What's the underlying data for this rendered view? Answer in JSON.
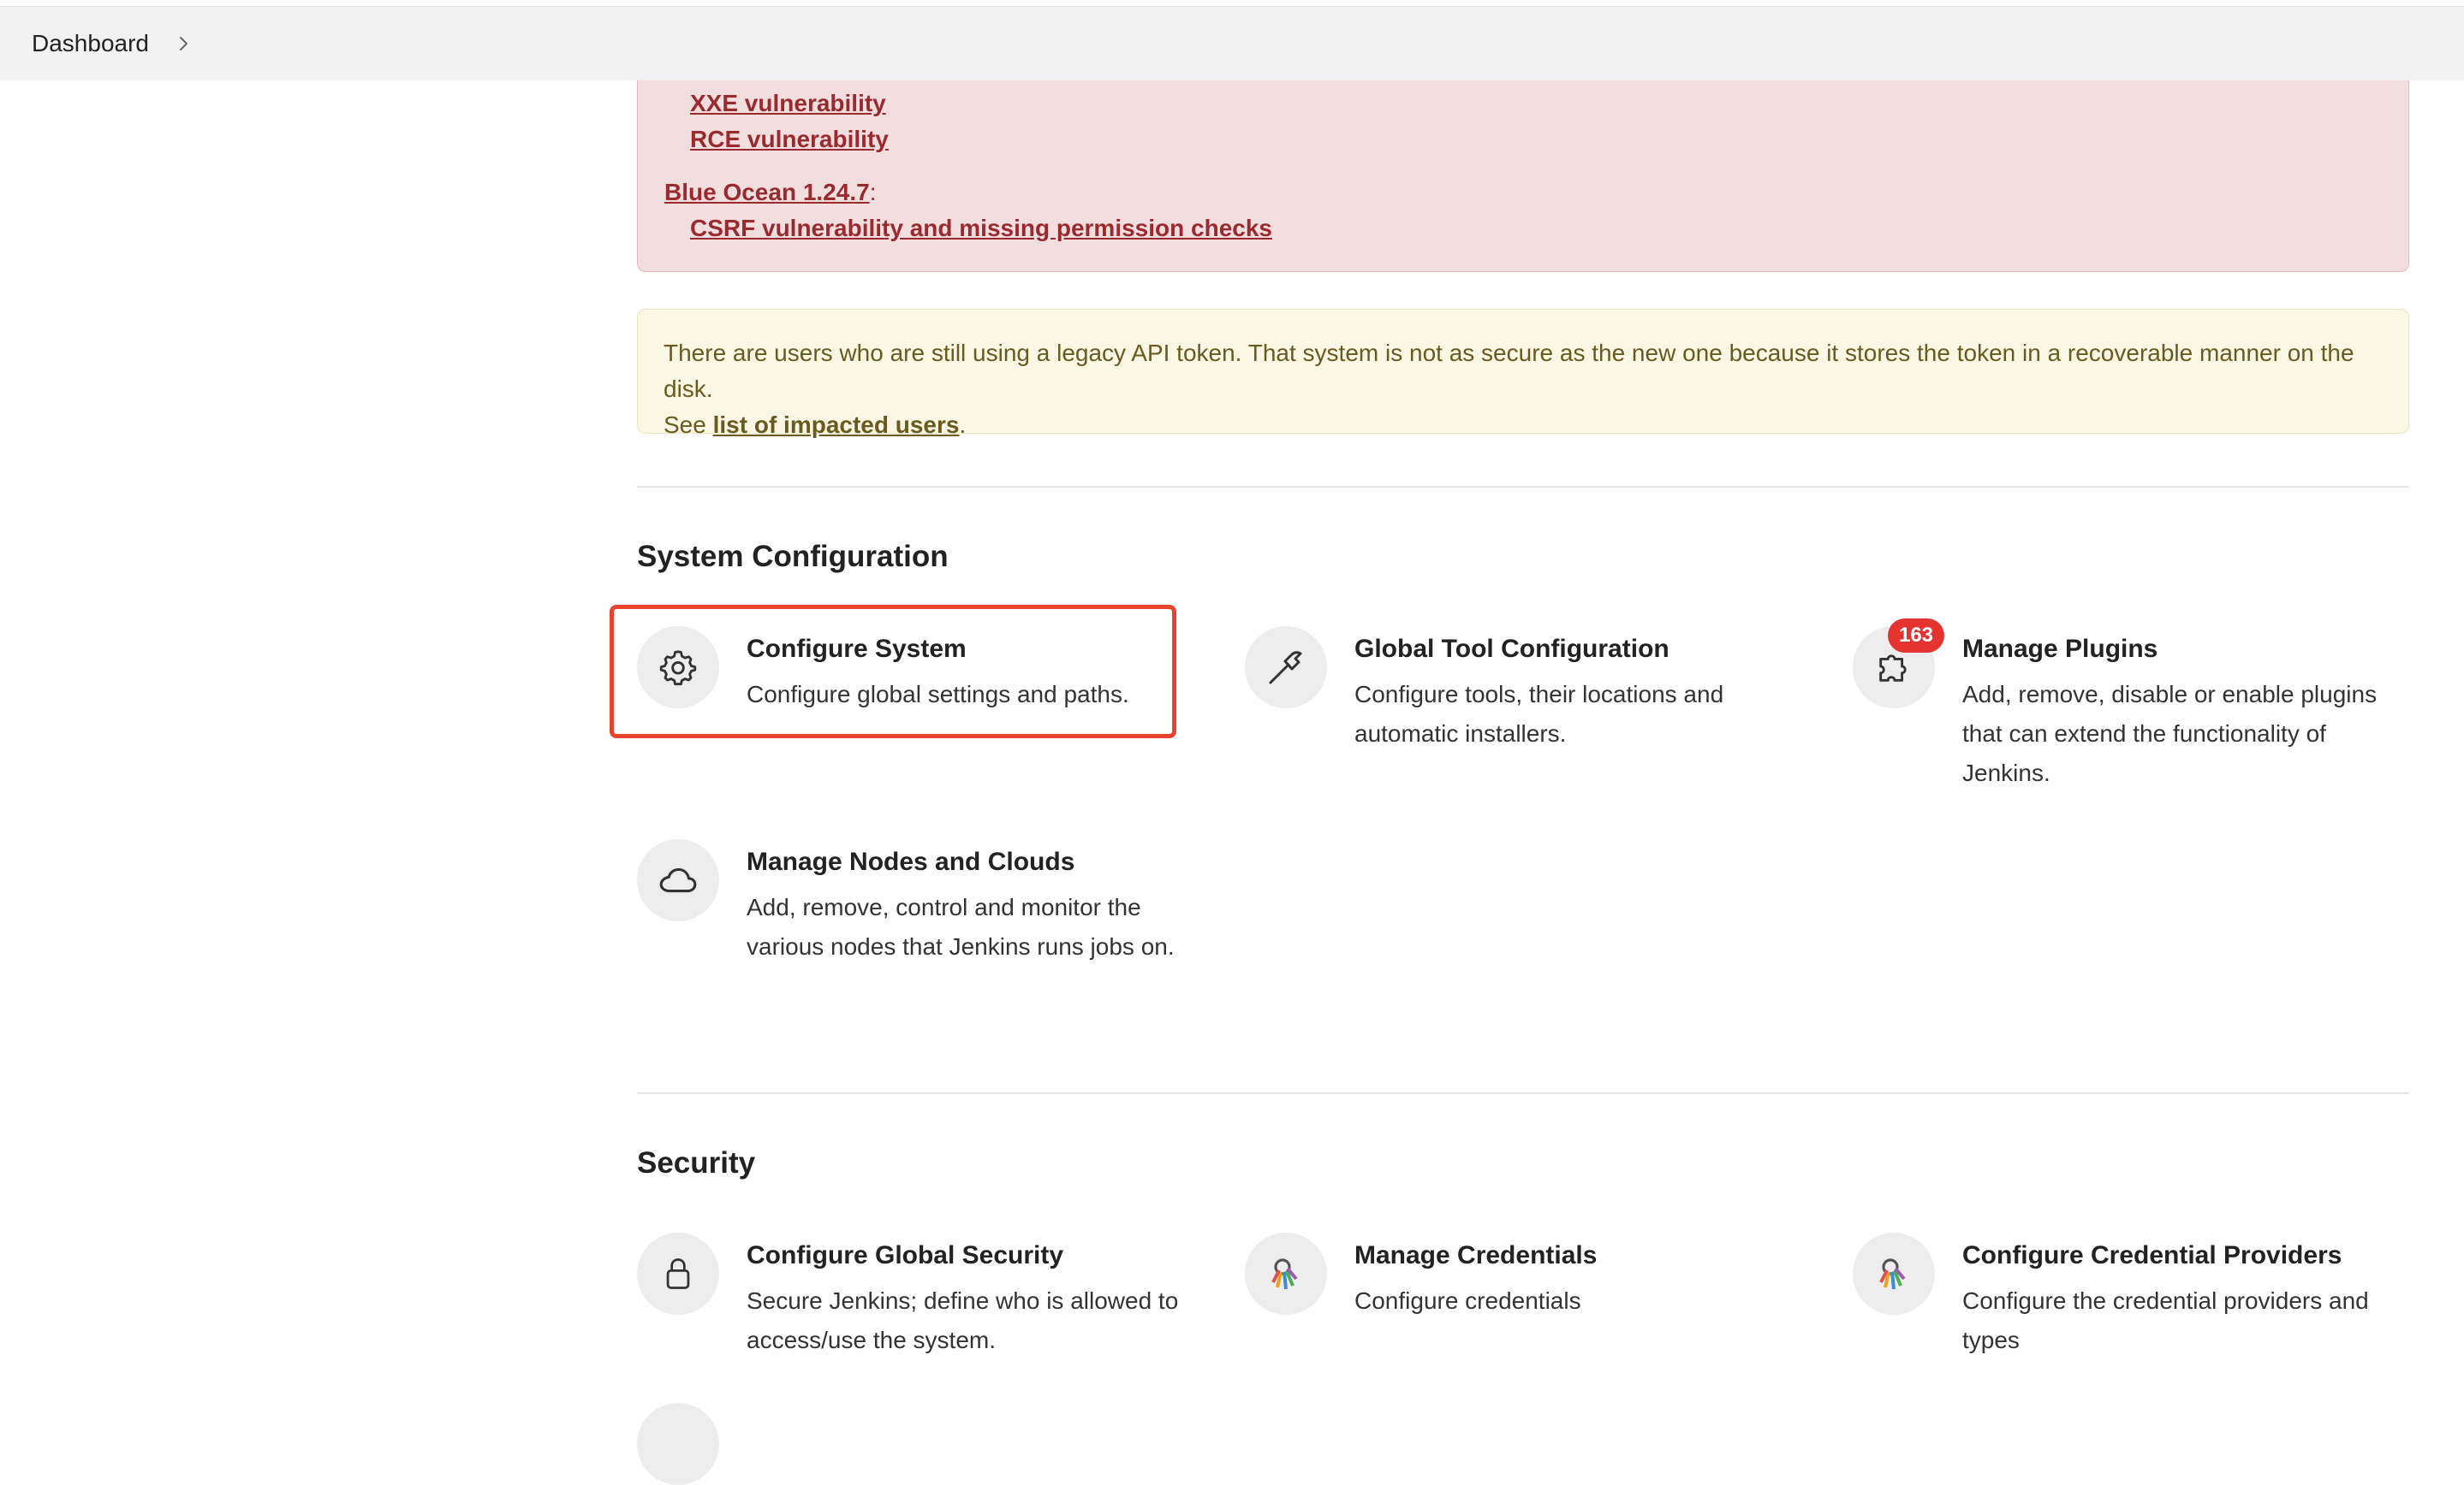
{
  "breadcrumb": {
    "items": [
      "Dashboard"
    ]
  },
  "advisories": {
    "links": [
      "XXE vulnerability",
      "RCE vulnerability"
    ],
    "plugin": {
      "name": "Blue Ocean 1.24.7",
      "suffix": ":"
    },
    "plugin_links": [
      "CSRF vulnerability and missing permission checks"
    ]
  },
  "legacy_token_warning": {
    "line1": "There are users who are still using a legacy API token. That system is not as secure as the new one because it stores the token in a recoverable manner on the disk.",
    "line2_prefix": "See ",
    "link": "list of impacted users",
    "line2_suffix": "."
  },
  "sections": {
    "system_configuration": {
      "title": "System Configuration",
      "tiles": [
        {
          "title": "Configure System",
          "desc": "Configure global settings and paths.",
          "icon": "gear-icon"
        },
        {
          "title": "Global Tool Configuration",
          "desc": "Configure tools, their locations and automatic installers.",
          "icon": "hammer-icon"
        },
        {
          "title": "Manage Plugins",
          "desc": "Add, remove, disable or enable plugins that can extend the functionality of Jenkins.",
          "icon": "puzzle-icon",
          "badge": "163"
        },
        {
          "title": "Manage Nodes and Clouds",
          "desc": "Add, remove, control and monitor the various nodes that Jenkins runs jobs on.",
          "icon": "cloud-icon"
        }
      ]
    },
    "security": {
      "title": "Security",
      "tiles": [
        {
          "title": "Configure Global Security",
          "desc": "Secure Jenkins; define who is allowed to access/use the system.",
          "icon": "lock-icon"
        },
        {
          "title": "Manage Credentials",
          "desc": "Configure credentials",
          "icon": "keys-icon"
        },
        {
          "title": "Configure Credential Providers",
          "desc": "Configure the credential providers and types",
          "icon": "keys-icon"
        }
      ]
    }
  },
  "colors": {
    "highlight": "#e8432e",
    "badge": "#e5332f",
    "danger_bg": "#f2dedf",
    "warning_bg": "#faf7e4"
  }
}
